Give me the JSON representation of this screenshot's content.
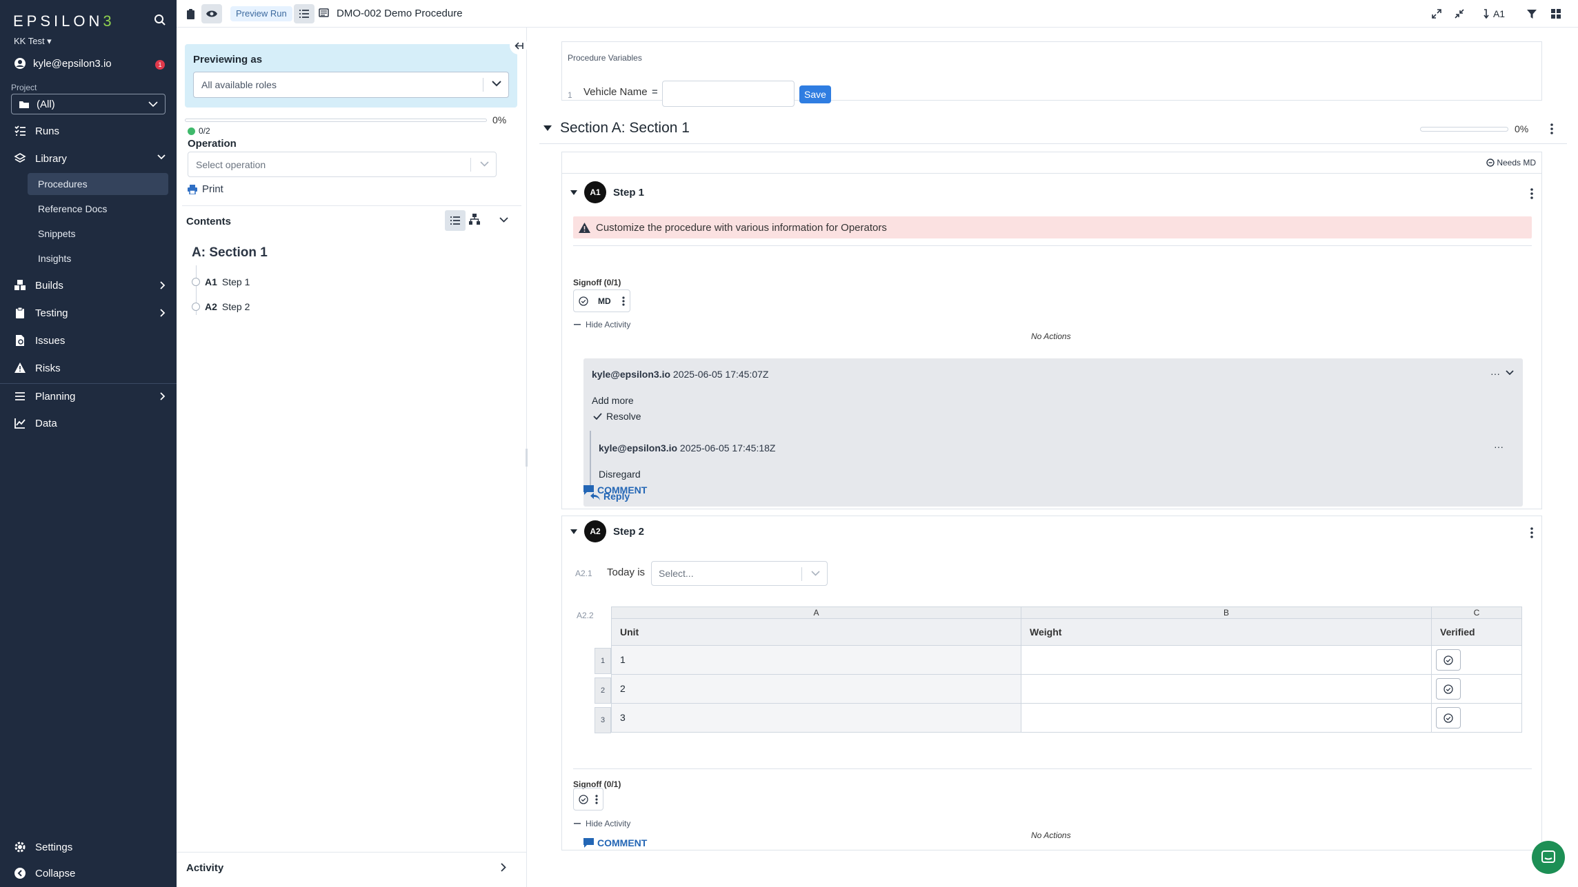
{
  "nav": {
    "logo": "EPSILON",
    "logo_accent": "3",
    "org": "KK Test",
    "user": "kyle@epsilon3.io",
    "user_badge": "1",
    "project_label": "Project",
    "project_value": "(All)",
    "items": {
      "runs": "Runs",
      "library": "Library",
      "procedures": "Procedures",
      "reference_docs": "Reference Docs",
      "snippets": "Snippets",
      "insights": "Insights",
      "builds": "Builds",
      "testing": "Testing",
      "issues": "Issues",
      "risks": "Risks",
      "planning": "Planning",
      "data": "Data",
      "settings": "Settings",
      "collapse": "Collapse"
    }
  },
  "topbar": {
    "preview_pill": "Preview Run",
    "doc_title": "DMO-002 Demo Procedure",
    "jump_label": "A1"
  },
  "middle": {
    "previewing_as": "Previewing as",
    "roles_value": "All available roles",
    "progress_pct": "0%",
    "progress_fraction": 0,
    "step_count": "0/2",
    "operation_label": "Operation",
    "operation_placeholder": "Select operation",
    "print": "Print",
    "contents": "Contents",
    "section_title": "A: Section 1",
    "toc": [
      {
        "key": "A1",
        "label": "Step 1"
      },
      {
        "key": "A2",
        "label": "Step 2"
      }
    ],
    "activity": "Activity"
  },
  "main": {
    "variables": {
      "label": "Procedure Variables",
      "row_num": "1",
      "name": "Vehicle Name",
      "equals": "=",
      "value": "",
      "save": "Save"
    },
    "section": {
      "title": "Section A: Section 1",
      "pct": "0%"
    },
    "step1": {
      "badge": "A1",
      "title": "Step 1",
      "needs": "Needs MD",
      "warning": "Customize the procedure with various information for Operators",
      "signoff_label": "Signoff (0/1)",
      "signoff_role": "MD",
      "hide_activity": "Hide Activity",
      "no_actions": "No Actions",
      "comment": {
        "author": "kyle@epsilon3.io",
        "timestamp": "2025-06-05 17:45:07Z",
        "dots": "···",
        "body": "Add more",
        "resolve": "Resolve",
        "reply": {
          "author": "kyle@epsilon3.io",
          "timestamp": "2025-06-05 17:45:18Z",
          "dots": "···",
          "body": "Disregard"
        },
        "reply_link": "Reply"
      },
      "comment_button": "COMMENT"
    },
    "step2": {
      "badge": "A2",
      "title": "Step 2",
      "sub1_num": "A2.1",
      "today_label": "Today is",
      "today_placeholder": "Select...",
      "sub2_num": "A2.2",
      "table": {
        "col_letters": [
          "A",
          "B",
          "C"
        ],
        "headers": [
          "Unit",
          "Weight",
          "Verified"
        ],
        "rows": [
          {
            "num": "1",
            "unit": "1",
            "weight": ""
          },
          {
            "num": "2",
            "unit": "2",
            "weight": ""
          },
          {
            "num": "3",
            "unit": "3",
            "weight": ""
          }
        ]
      },
      "signoff_label": "Signoff (0/1)",
      "hide_activity": "Hide Activity",
      "no_actions": "No Actions",
      "comment_button": "COMMENT"
    }
  },
  "colors": {
    "nav_bg": "#1f2b3f",
    "accent": "#2f7de1",
    "preview_bg": "#d6eef9",
    "warning_bg": "#fbe1e1",
    "link": "#2366b5",
    "chat": "#1d8f55"
  }
}
